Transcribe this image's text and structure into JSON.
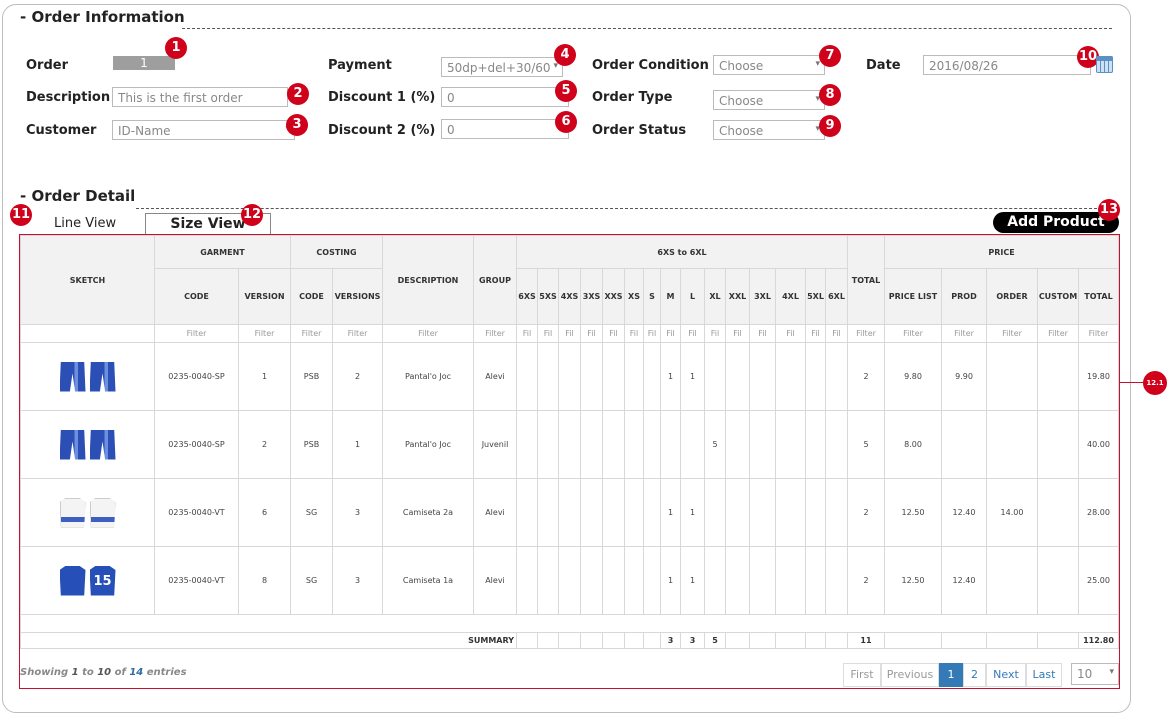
{
  "order_info": {
    "title": "- Order Information",
    "order_label": "Order",
    "order_value": "1",
    "description_label": "Description",
    "description_value": "This is the first order",
    "customer_label": "Customer",
    "customer_value": "ID-Name",
    "payment_label": "Payment",
    "payment_value": "50dp+del+30/60",
    "discount1_label": "Discount 1 (%)",
    "discount1_value": "0",
    "discount2_label": "Discount 2 (%)",
    "discount2_value": "0",
    "order_condition_label": "Order Condition",
    "order_condition_value": "Choose",
    "order_type_label": "Order Type",
    "order_type_value": "Choose",
    "order_status_label": "Order Status",
    "order_status_value": "Choose",
    "date_label": "Date",
    "date_value": "2016/08/26"
  },
  "order_detail": {
    "title": "- Order Detail",
    "tab_line": "Line View",
    "tab_size": "Size View",
    "add_product": "Add Product"
  },
  "badges": [
    "1",
    "2",
    "3",
    "4",
    "5",
    "6",
    "7",
    "8",
    "9",
    "10",
    "11",
    "12",
    "13",
    "12.1"
  ],
  "table": {
    "group_headers": {
      "sketch": "SKETCH",
      "garment": "GARMENT",
      "costing": "COSTING",
      "description": "DESCRIPTION",
      "group": "GROUP",
      "sizes": "6XS to 6XL",
      "total": "TOTAL",
      "price": "PRICE"
    },
    "sub_headers": {
      "garment_code": "CODE",
      "garment_version": "VERSION",
      "costing_code": "CODE",
      "costing_versions": "VERSIONS",
      "price_list": "PRICE LIST",
      "prod": "PROD",
      "order": "ORDER",
      "custom": "CUSTOM",
      "price_total": "TOTAL"
    },
    "sizes": [
      "6XS",
      "5XS",
      "4XS",
      "3XS",
      "XXS",
      "XS",
      "S",
      "M",
      "L",
      "XL",
      "XXL",
      "3XL",
      "4XL",
      "5XL",
      "6XL"
    ],
    "filter_label": "Filter",
    "filter_short": "Fil",
    "rows": [
      {
        "sketch": "shorts",
        "code": "0235-0040-SP",
        "version": "1",
        "costing_code": "PSB",
        "costing_version": "2",
        "description": "Pantal'o Joc",
        "group": "Alevi",
        "M": "1",
        "L": "1",
        "XL": "",
        "total": "2",
        "price_list": "9.80",
        "prod": "9.90",
        "order": "",
        "custom": "",
        "price_total": "19.80"
      },
      {
        "sketch": "shorts",
        "code": "0235-0040-SP",
        "version": "2",
        "costing_code": "PSB",
        "costing_version": "1",
        "description": "Pantal'o Joc",
        "group": "Juvenil",
        "M": "",
        "L": "",
        "XL": "5",
        "total": "5",
        "price_list": "8.00",
        "prod": "",
        "order": "",
        "custom": "",
        "price_total": "40.00"
      },
      {
        "sketch": "jersey-white",
        "code": "0235-0040-VT",
        "version": "6",
        "costing_code": "SG",
        "costing_version": "3",
        "description": "Camiseta 2a",
        "group": "Alevi",
        "M": "1",
        "L": "1",
        "XL": "",
        "total": "2",
        "price_list": "12.50",
        "prod": "12.40",
        "order": "14.00",
        "custom": "",
        "price_total": "28.00"
      },
      {
        "sketch": "jersey-blue",
        "code": "0235-0040-VT",
        "version": "8",
        "costing_code": "SG",
        "costing_version": "3",
        "description": "Camiseta 1a",
        "group": "Alevi",
        "M": "1",
        "L": "1",
        "XL": "",
        "total": "2",
        "price_list": "12.50",
        "prod": "12.40",
        "order": "",
        "custom": "",
        "price_total": "25.00"
      }
    ],
    "summary": {
      "label": "SUMMARY",
      "M": "3",
      "L": "3",
      "XL": "5",
      "total": "11",
      "price_total": "112.80"
    }
  },
  "pagination": {
    "showing_prefix": "Showing",
    "from": "1",
    "to_word": "to",
    "to": "10",
    "of_word": "of",
    "total": "14",
    "entries_word": "entries",
    "first": "First",
    "previous": "Previous",
    "page1": "1",
    "page2": "2",
    "next": "Next",
    "last": "Last",
    "page_size": "10"
  },
  "colors": {
    "accent_red": "#d0021b",
    "table_border": "#c8102e",
    "page_active": "#337ab7"
  }
}
